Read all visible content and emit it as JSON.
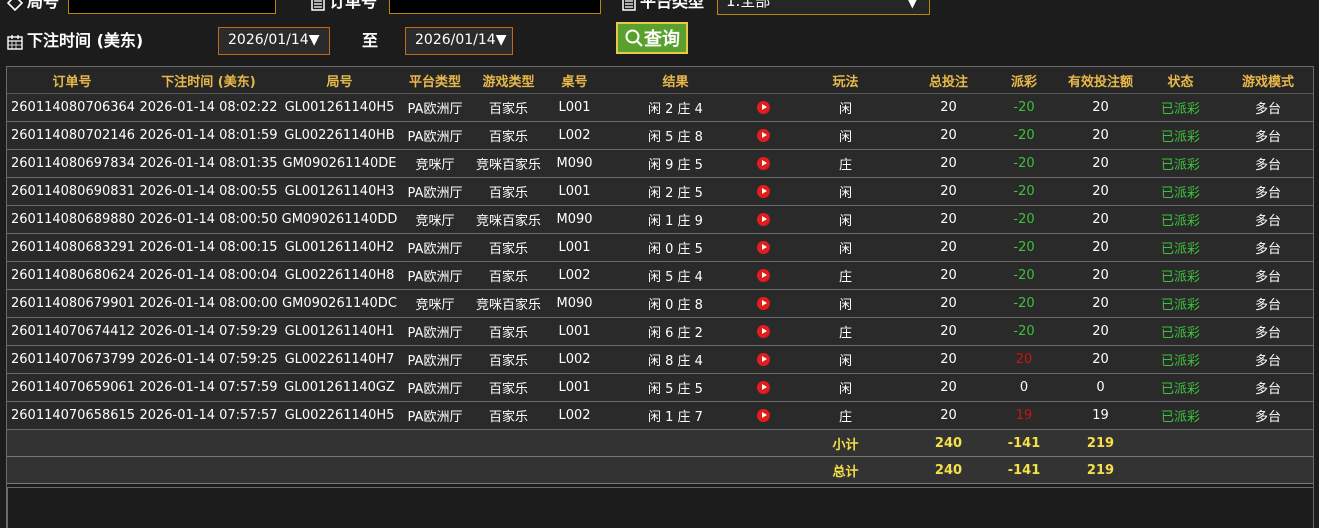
{
  "filters": {
    "round_label": "局号",
    "round_value": "",
    "order_label": "订单号",
    "order_value": "",
    "platform_label": "平台类型",
    "platform_value": "1.全部",
    "bet_time_label": "下注时间 (美东)",
    "date_from": "2026/01/14",
    "to_label": "至",
    "date_to": "2026/01/14",
    "query_label": "查询"
  },
  "table": {
    "headers": [
      "订单号",
      "下注时间 (美东)",
      "局号",
      "平台类型",
      "游戏类型",
      "桌号",
      "结果",
      "",
      "玩法",
      "总投注",
      "派彩",
      "有效投注额",
      "状态",
      "游戏模式"
    ],
    "rows": [
      [
        "260114080706364",
        "2026-01-14 08:02:22",
        "GL001261140H5",
        "PA欧洲厅",
        "百家乐",
        "L001",
        "闲 2 庄 4",
        "闲",
        "20",
        "-20",
        "20",
        "已派彩",
        "多台"
      ],
      [
        "260114080702146",
        "2026-01-14 08:01:59",
        "GL002261140HB",
        "PA欧洲厅",
        "百家乐",
        "L002",
        "闲 5 庄 8",
        "闲",
        "20",
        "-20",
        "20",
        "已派彩",
        "多台"
      ],
      [
        "260114080697834",
        "2026-01-14 08:01:35",
        "GM090261140DE",
        "竞咪厅",
        "竞咪百家乐",
        "M090",
        "闲 9 庄 5",
        "庄",
        "20",
        "-20",
        "20",
        "已派彩",
        "多台"
      ],
      [
        "260114080690831",
        "2026-01-14 08:00:55",
        "GL001261140H3",
        "PA欧洲厅",
        "百家乐",
        "L001",
        "闲 2 庄 5",
        "闲",
        "20",
        "-20",
        "20",
        "已派彩",
        "多台"
      ],
      [
        "260114080689880",
        "2026-01-14 08:00:50",
        "GM090261140DD",
        "竞咪厅",
        "竞咪百家乐",
        "M090",
        "闲 1 庄 9",
        "闲",
        "20",
        "-20",
        "20",
        "已派彩",
        "多台"
      ],
      [
        "260114080683291",
        "2026-01-14 08:00:15",
        "GL001261140H2",
        "PA欧洲厅",
        "百家乐",
        "L001",
        "闲 0 庄 5",
        "闲",
        "20",
        "-20",
        "20",
        "已派彩",
        "多台"
      ],
      [
        "260114080680624",
        "2026-01-14 08:00:04",
        "GL002261140H8",
        "PA欧洲厅",
        "百家乐",
        "L002",
        "闲 5 庄 4",
        "庄",
        "20",
        "-20",
        "20",
        "已派彩",
        "多台"
      ],
      [
        "260114080679901",
        "2026-01-14 08:00:00",
        "GM090261140DC",
        "竞咪厅",
        "竞咪百家乐",
        "M090",
        "闲 0 庄 8",
        "闲",
        "20",
        "-20",
        "20",
        "已派彩",
        "多台"
      ],
      [
        "260114070674412",
        "2026-01-14 07:59:29",
        "GL001261140H1",
        "PA欧洲厅",
        "百家乐",
        "L001",
        "闲 6 庄 2",
        "庄",
        "20",
        "-20",
        "20",
        "已派彩",
        "多台"
      ],
      [
        "260114070673799",
        "2026-01-14 07:59:25",
        "GL002261140H7",
        "PA欧洲厅",
        "百家乐",
        "L002",
        "闲 8 庄 4",
        "闲",
        "20",
        "20",
        "20",
        "已派彩",
        "多台"
      ],
      [
        "260114070659061",
        "2026-01-14 07:57:59",
        "GL001261140GZ",
        "PA欧洲厅",
        "百家乐",
        "L001",
        "闲 5 庄 5",
        "闲",
        "20",
        "0",
        "0",
        "已派彩",
        "多台"
      ],
      [
        "260114070658615",
        "2026-01-14 07:57:57",
        "GL002261140H5",
        "PA欧洲厅",
        "百家乐",
        "L002",
        "闲 1 庄 7",
        "庄",
        "20",
        "19",
        "19",
        "已派彩",
        "多台"
      ]
    ],
    "subtotal": {
      "label": "小计",
      "total_bet": "240",
      "payout": "-141",
      "valid_bet": "219"
    },
    "total": {
      "label": "总计",
      "total_bet": "240",
      "payout": "-141",
      "valid_bet": "219"
    }
  },
  "colors": {
    "accent": "#e8b94a",
    "payout_negative": "#3ec13e",
    "payout_positive": "#c81414",
    "status": "#3ec13e",
    "sum_text": "#f5e04a"
  },
  "icons": {
    "round": "diamond-icon",
    "order": "document-icon",
    "platform": "document-icon",
    "date": "calendar-icon",
    "query": "search-icon",
    "replay": "play-icon"
  }
}
